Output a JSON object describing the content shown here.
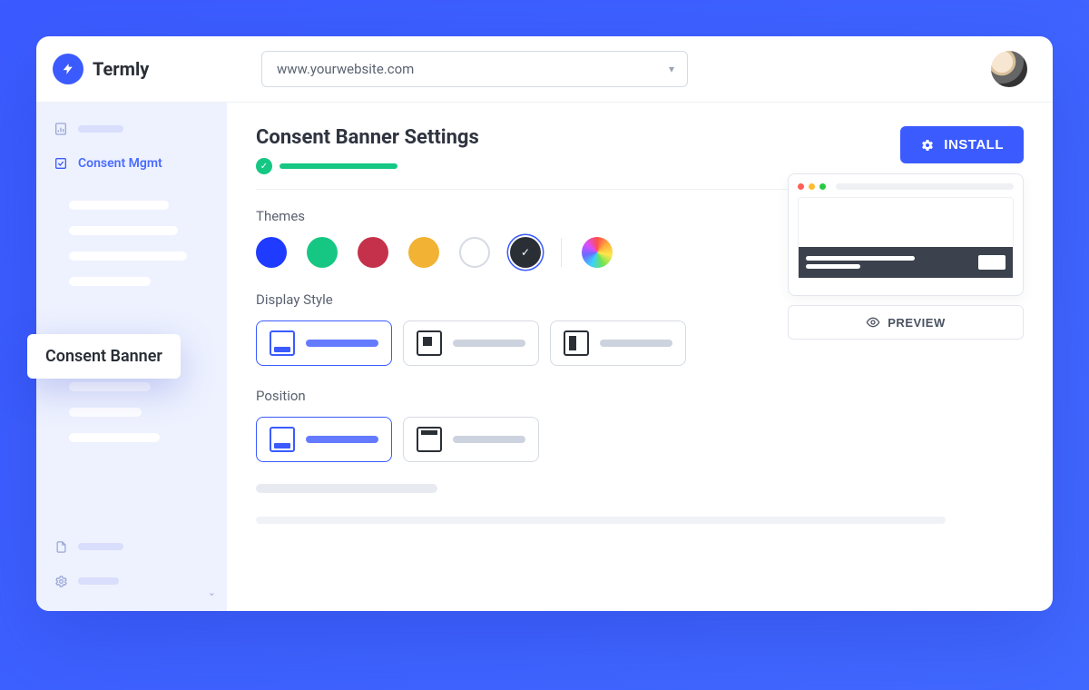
{
  "brand": {
    "name": "Termly"
  },
  "header": {
    "site_selected": "www.yourwebsite.com"
  },
  "sidebar": {
    "active_label": "Consent Mgmt",
    "tooltip": "Consent Banner"
  },
  "page": {
    "title": "Consent Banner Settings",
    "install_label": "INSTALL"
  },
  "themes": {
    "label": "Themes",
    "colors": [
      "#1f3bff",
      "#16c784",
      "#c5314b",
      "#f2b233",
      "outline",
      "selected-dark"
    ],
    "custom": "rainbow"
  },
  "display_style": {
    "label": "Display Style",
    "options": [
      {
        "id": "banner",
        "selected": true
      },
      {
        "id": "modal-small",
        "selected": false
      },
      {
        "id": "modal-left",
        "selected": false
      }
    ]
  },
  "position": {
    "label": "Position",
    "options": [
      {
        "id": "bottom",
        "selected": true
      },
      {
        "id": "top",
        "selected": false
      }
    ]
  },
  "preview": {
    "button_label": "PREVIEW"
  }
}
